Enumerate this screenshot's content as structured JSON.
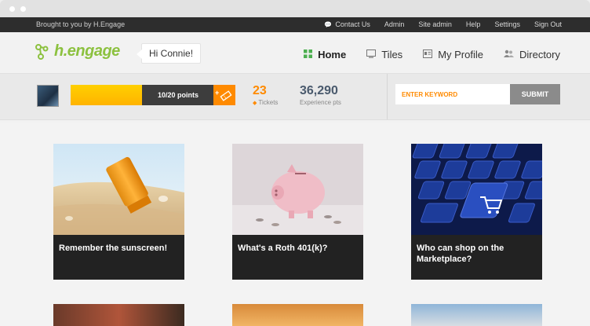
{
  "topbar": {
    "brought": "Brought to you by H.Engage",
    "links": [
      "Contact Us",
      "Admin",
      "Site admin",
      "Help",
      "Settings",
      "Sign Out"
    ]
  },
  "header": {
    "logo": "h.engage",
    "greeting": "Hi Connie!",
    "nav": [
      {
        "label": "Home",
        "icon": "grid-icon",
        "active": true
      },
      {
        "label": "Tiles",
        "icon": "monitor-icon",
        "active": false
      },
      {
        "label": "My Profile",
        "icon": "profile-icon",
        "active": false
      },
      {
        "label": "Directory",
        "icon": "people-icon",
        "active": false
      }
    ]
  },
  "stats": {
    "progress_label": "10/20 points",
    "progress_fraction": 0.5,
    "tickets_value": "23",
    "tickets_label": "Tickets",
    "xp_value": "36,290",
    "xp_label": "Experience pts"
  },
  "search": {
    "placeholder": "ENTER KEYWORD",
    "submit_label": "SUBMIT"
  },
  "tiles": [
    {
      "caption": "Remember the sunscreen!"
    },
    {
      "caption": "What's a Roth 401(k)?"
    },
    {
      "caption": "Who can shop on the Marketplace?"
    }
  ],
  "colors": {
    "accent": "#ff8a00",
    "brand": "#8cc13f",
    "topbar": "#2d2d2d"
  }
}
